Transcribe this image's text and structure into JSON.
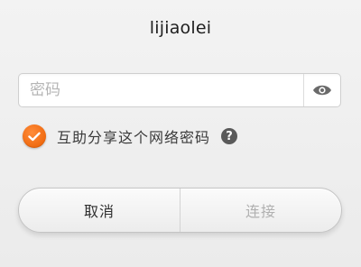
{
  "dialog": {
    "title": "lijiaolei",
    "password": {
      "placeholder": "密码",
      "value": "",
      "toggle_icon": "eye-icon"
    },
    "share": {
      "checked": true,
      "label": "互助分享这个网络密码",
      "check_icon": "checkmark-icon",
      "help_icon": "question-icon",
      "help_glyph": "?"
    },
    "buttons": {
      "cancel_label": "取消",
      "connect_label": "连接",
      "connect_enabled": false
    },
    "colors": {
      "accent": "#f06a10",
      "disabled_text": "#b0b0b0"
    }
  }
}
